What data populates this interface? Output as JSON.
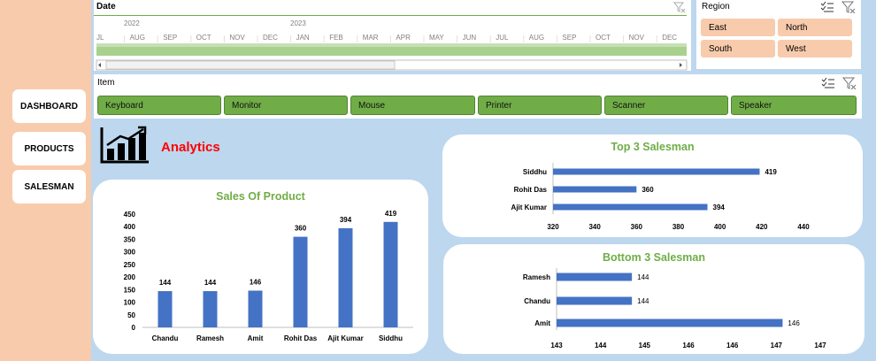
{
  "colors": {
    "bar": "#4472c4",
    "accent": "#70ad47",
    "title_red": "#ff0000",
    "region_fill": "#f8cbad"
  },
  "nav": {
    "dashboard": "DASHBOARD",
    "products": "PRODUCTS",
    "salesman": "SALESMAN"
  },
  "date_slicer": {
    "title": "Date",
    "years": [
      "2022",
      "2023"
    ],
    "months": [
      "JL",
      "AUG",
      "SEP",
      "OCT",
      "NOV",
      "DEC",
      "JAN",
      "FEB",
      "MAR",
      "APR",
      "MAY",
      "JUN",
      "JUL",
      "AUG",
      "SEP",
      "OCT",
      "NOV",
      "DEC"
    ],
    "icons": [
      "clear-filter-icon"
    ]
  },
  "region_slicer": {
    "title": "Region",
    "items": [
      "East",
      "North",
      "South",
      "West"
    ]
  },
  "item_slicer": {
    "title": "Item",
    "items": [
      "Keyboard",
      "Monitor",
      "Mouse",
      "Printer",
      "Scanner",
      "Speaker"
    ]
  },
  "analytics": {
    "title": "Analytics",
    "icon": "bar-chart-growth-icon"
  },
  "chart_data": [
    {
      "type": "bar",
      "title": "Sales Of Product",
      "categories": [
        "Chandu",
        "Ramesh",
        "Amit",
        "Rohit Das",
        "Ajit Kumar",
        "Siddhu"
      ],
      "values": [
        144,
        144,
        146,
        360,
        394,
        419
      ],
      "yticks": [
        "0",
        "50",
        "100",
        "150",
        "200",
        "250",
        "300",
        "350",
        "400",
        "450"
      ],
      "ylim": [
        0,
        450
      ]
    },
    {
      "type": "bar",
      "orientation": "horizontal",
      "title": "Top 3 Salesman",
      "categories": [
        "Siddhu",
        "Rohit Das",
        "Ajit Kumar"
      ],
      "values": [
        419,
        360,
        394
      ],
      "xticks": [
        "320",
        "340",
        "360",
        "380",
        "400",
        "420",
        "440"
      ],
      "xlim": [
        320,
        440
      ]
    },
    {
      "type": "bar",
      "orientation": "horizontal",
      "title": "Bottom 3 Salesman",
      "categories": [
        "Ramesh",
        "Chandu",
        "Amit"
      ],
      "values": [
        144,
        144,
        146
      ],
      "xticks": [
        "143",
        "144",
        "145",
        "146",
        "146",
        "147",
        "147"
      ],
      "xlim": [
        143,
        146.5
      ]
    }
  ]
}
